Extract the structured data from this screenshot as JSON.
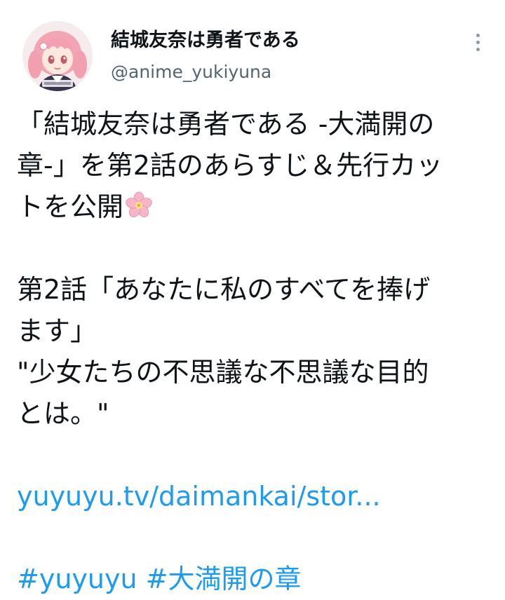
{
  "author": {
    "display_name": "結城友奈は勇者である",
    "handle": "@anime_yukiyuna",
    "avatar_icon": "anime-character-avatar",
    "avatar_text": "結城友奈は勇者である"
  },
  "more_icon": "more-vertical-icon",
  "tweet": {
    "lines": [
      "「結城友奈は勇者である -大満開の",
      "章-」を第2話のあらすじ＆先行カッ",
      "トを公開"
    ],
    "emoji": "cherry-blossom-emoji",
    "episode_lines": [
      "第2話「あなたに私のすべてを捧げ",
      "ます」",
      "\"少女たちの不思議な不思議な目的",
      "とは。\""
    ],
    "link": "yuyuyu.tv/daimankai/stor...",
    "hashtags": [
      "#yuyuyu",
      "#大満開の章"
    ]
  },
  "colors": {
    "link": "#1d9bf0",
    "text": "#0f1419",
    "secondary": "#536471"
  }
}
